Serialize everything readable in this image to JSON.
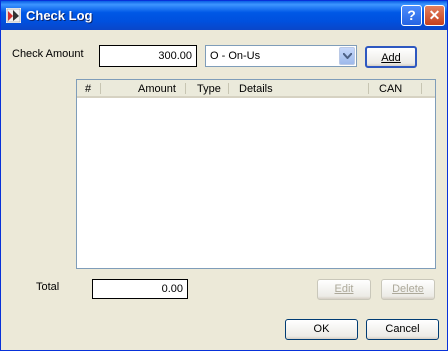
{
  "window": {
    "title": "Check Log"
  },
  "form": {
    "check_amount_label": "Check Amount",
    "check_amount_value": "300.00",
    "type_selected": "O - On-Us",
    "add_label": "Add",
    "total_label": "Total",
    "total_value": "0.00"
  },
  "table": {
    "columns": [
      "#",
      "Amount",
      "Type",
      "Details",
      "CAN"
    ],
    "rows": []
  },
  "buttons": {
    "edit": "Edit",
    "delete": "Delete",
    "ok": "OK",
    "cancel": "Cancel"
  },
  "colors": {
    "title_bar": "#0058e6",
    "dialog_bg": "#ece9d8",
    "field_border": "#7f9db9"
  },
  "icons": {
    "app": "check-log-app-icon",
    "help": "help-icon",
    "close": "close-icon",
    "dropdown": "chevron-down-icon"
  }
}
